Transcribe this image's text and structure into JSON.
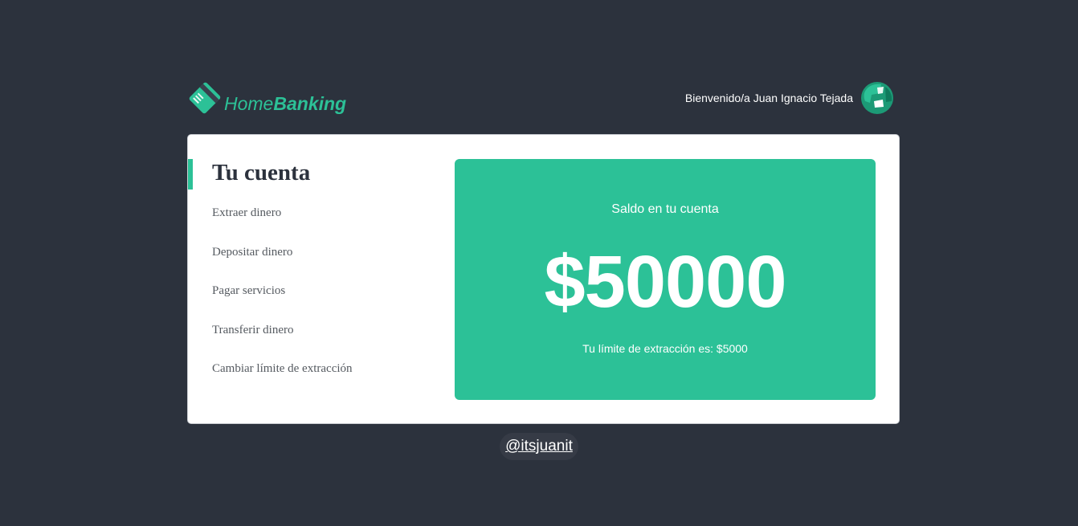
{
  "header": {
    "logo": {
      "text_light": "Home",
      "text_bold": "Banking",
      "icon": "credit-card-icon",
      "color": "#2cc197"
    },
    "welcome_text": "Bienvenido/a Juan Ignacio Tejada",
    "avatar_icon": "user-avatar-icon"
  },
  "menu": {
    "title": "Tu cuenta",
    "items": [
      {
        "label": "Extraer dinero"
      },
      {
        "label": "Depositar dinero"
      },
      {
        "label": "Pagar servicios"
      },
      {
        "label": "Transferir dinero"
      },
      {
        "label": "Cambiar límite de extracción"
      }
    ]
  },
  "balance": {
    "label": "Saldo en tu cuenta",
    "amount": "$50000",
    "limit_text": "Tu límite de extracción es: $5000"
  },
  "footer": {
    "link_text": "@itsjuanit"
  },
  "colors": {
    "background": "#2c323d",
    "accent": "#2cc197",
    "card": "#ffffff"
  }
}
